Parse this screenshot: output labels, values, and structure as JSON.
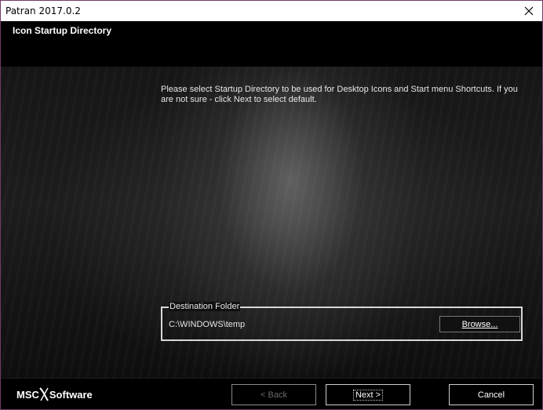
{
  "window": {
    "title": "Patran 2017.0.2"
  },
  "header": {
    "heading": "Icon Startup Directory"
  },
  "content": {
    "info_text": "Please select Startup Directory to be used for Desktop Icons and Start menu Shortcuts. If you are not sure - click Next to select default."
  },
  "destination": {
    "legend": "Destination Folder",
    "path": "C:\\WINDOWS\\temp",
    "browse_label": "Browse..."
  },
  "footer": {
    "logo_left": "MSC",
    "logo_right": "Software",
    "back_label": "< Back",
    "next_label": "Next >",
    "cancel_label": "Cancel"
  },
  "icons": {
    "close": "close-icon",
    "logo": "msc-software-logo"
  }
}
